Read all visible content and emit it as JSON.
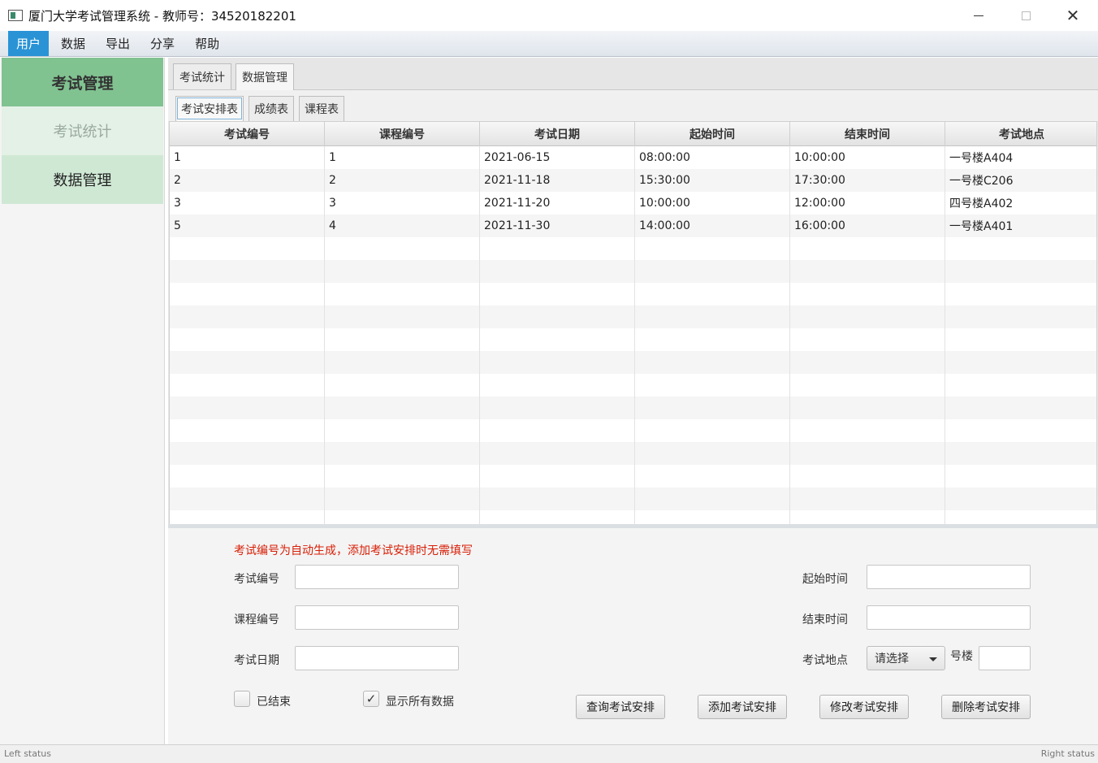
{
  "window": {
    "title": "厦门大学考试管理系统 - 教师号：34520182201",
    "min_glyph": "",
    "close_glyph": "✕"
  },
  "menu": [
    {
      "label": "用户",
      "active": true
    },
    {
      "label": "数据"
    },
    {
      "label": "导出"
    },
    {
      "label": "分享"
    },
    {
      "label": "帮助"
    }
  ],
  "sidebar": {
    "header": "考试管理",
    "items": [
      {
        "label": "考试统计"
      },
      {
        "label": "数据管理"
      }
    ]
  },
  "tabs_main": [
    {
      "label": "考试统计"
    },
    {
      "label": "数据管理",
      "selected": true
    }
  ],
  "tabs_sub": [
    {
      "label": "考试安排表",
      "selected": true
    },
    {
      "label": "成绩表"
    },
    {
      "label": "课程表"
    }
  ],
  "table": {
    "columns": [
      "考试编号",
      "课程编号",
      "考试日期",
      "起始时间",
      "结束时间",
      "考试地点"
    ],
    "rows": [
      [
        "1",
        "1",
        "2021-06-15",
        "08:00:00",
        "10:00:00",
        "一号楼A404"
      ],
      [
        "2",
        "2",
        "2021-11-18",
        "15:30:00",
        "17:30:00",
        "一号楼C206"
      ],
      [
        "3",
        "3",
        "2021-11-20",
        "10:00:00",
        "12:00:00",
        "四号楼A402"
      ],
      [
        "5",
        "4",
        "2021-11-30",
        "14:00:00",
        "16:00:00",
        "一号楼A401"
      ],
      [
        "",
        "",
        "",
        "",
        "",
        ""
      ],
      [
        "",
        "",
        "",
        "",
        "",
        ""
      ],
      [
        "",
        "",
        "",
        "",
        "",
        ""
      ],
      [
        "",
        "",
        "",
        "",
        "",
        ""
      ],
      [
        "",
        "",
        "",
        "",
        "",
        ""
      ],
      [
        "",
        "",
        "",
        "",
        "",
        ""
      ],
      [
        "",
        "",
        "",
        "",
        "",
        ""
      ],
      [
        "",
        "",
        "",
        "",
        "",
        ""
      ],
      [
        "",
        "",
        "",
        "",
        "",
        ""
      ],
      [
        "",
        "",
        "",
        "",
        "",
        ""
      ],
      [
        "",
        "",
        "",
        "",
        "",
        ""
      ],
      [
        "",
        "",
        "",
        "",
        "",
        ""
      ],
      [
        "",
        "",
        "",
        "",
        "",
        ""
      ]
    ]
  },
  "form": {
    "hint": "考试编号为自动生成，添加考试安排时无需填写",
    "exam_id_label": "考试编号",
    "course_id_label": "课程编号",
    "exam_date_label": "考试日期",
    "start_time_label": "起始时间",
    "end_time_label": "结束时间",
    "location_label": "考试地点",
    "location_select": "请选择",
    "building_suffix": "号楼",
    "exam_id_value": "",
    "course_id_value": "",
    "exam_date_value": "",
    "start_time_value": "",
    "end_time_value": "",
    "room_value": "",
    "ended_label": "已结束",
    "ended_checked": false,
    "show_all_label": "显示所有数据",
    "show_all_checked": true,
    "check_mark": "✓",
    "buttons": {
      "query": "查询考试安排",
      "add": "添加考试安排",
      "modify": "修改考试安排",
      "delete": "删除考试安排"
    }
  },
  "status": {
    "left": "Left status",
    "right": "Right status"
  },
  "colors": {
    "menu_active": "#2a93d6",
    "sidebar_header": "#81c291",
    "hint_text": "#d81e06"
  }
}
